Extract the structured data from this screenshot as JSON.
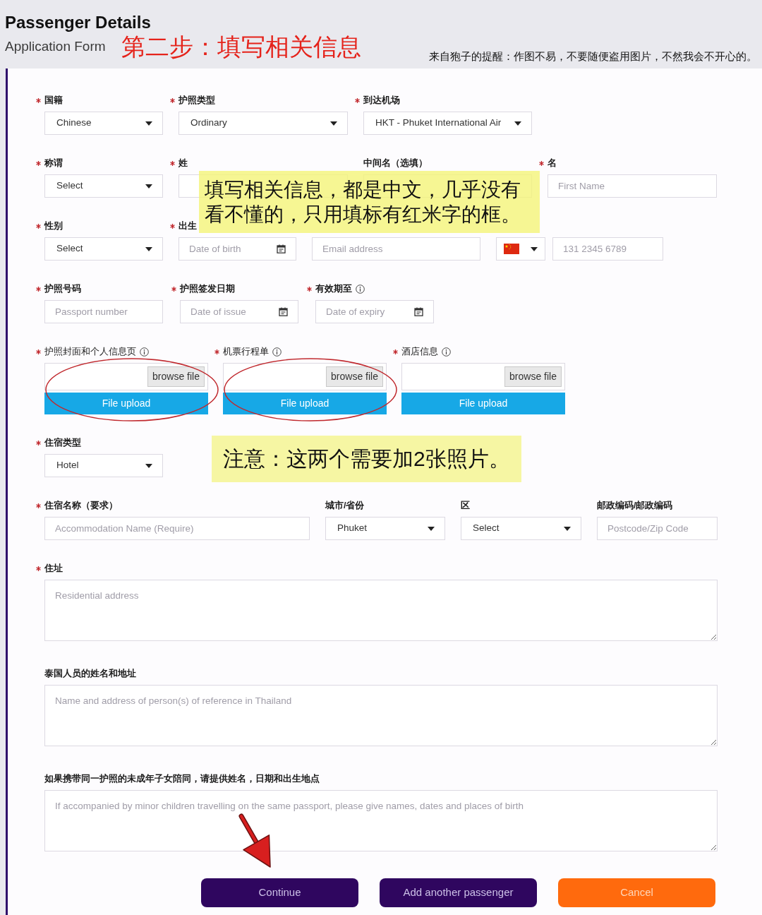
{
  "header": {
    "title": "Passenger Details",
    "subtitle": "Application Form",
    "annotation": "第二步：填写相关信息",
    "author_note": "来自狍子的提醒：作图不易，不要随便盗用图片，不然我会不开心的。"
  },
  "form": {
    "rows": [
      {
        "fields": [
          {
            "kind": "select",
            "label": "国籍",
            "required": true,
            "info": false,
            "value": "Chinese"
          },
          {
            "kind": "select",
            "label": "护照类型",
            "required": true,
            "info": false,
            "value": "Ordinary"
          },
          {
            "kind": "select",
            "label": "到达机场",
            "required": true,
            "info": false,
            "value": "HKT - Phuket International Air"
          }
        ]
      },
      {
        "fields": [
          {
            "kind": "select",
            "label": "称谓",
            "required": true,
            "info": false,
            "value": "Select"
          },
          {
            "kind": "input",
            "label": "姓",
            "required": true,
            "info": false
          },
          {
            "kind": "input",
            "label": "中间名（选填）",
            "required": false,
            "info": false
          },
          {
            "kind": "input",
            "label": "名",
            "required": true,
            "info": false,
            "placeholder": "First Name"
          }
        ],
        "note": {
          "kind": "overlay",
          "text": "填写相关信息，都是中文，几乎没有看不懂的，只用填标有红米字的框。"
        }
      },
      {
        "fields": [
          {
            "kind": "select",
            "label": "性别",
            "required": true,
            "info": false,
            "value": "Select"
          },
          {
            "kind": "date",
            "label": "出生",
            "required": true,
            "info": false,
            "placeholder": "Date of birth"
          },
          {
            "kind": "input",
            "placeholder": "Email address"
          },
          {
            "kind": "phone",
            "placeholder": "131 2345 6789"
          }
        ]
      },
      {
        "fields": [
          {
            "kind": "input",
            "label": "护照号码",
            "required": true,
            "info": false,
            "placeholder": "Passport number"
          },
          {
            "kind": "date",
            "label": "护照签发日期",
            "required": true,
            "info": false,
            "placeholder": "Date of issue"
          },
          {
            "kind": "date",
            "label": "有效期至",
            "required": true,
            "info": true,
            "placeholder": "Date of expiry"
          }
        ]
      },
      {
        "fields": [
          {
            "kind": "file",
            "label": "护照封面和个人信息页",
            "required": true,
            "info": true,
            "browse": "browse file",
            "upload": "File upload",
            "circled": true
          },
          {
            "kind": "file",
            "label": "机票行程单",
            "required": true,
            "info": true,
            "browse": "browse file",
            "upload": "File upload",
            "circled": true
          },
          {
            "kind": "file",
            "label": "酒店信息",
            "required": true,
            "info": true,
            "browse": "browse file",
            "upload": "File upload",
            "circled": false
          }
        ]
      },
      {
        "fields": [
          {
            "kind": "select",
            "label": "住宿类型",
            "required": true,
            "info": false,
            "value": "Hotel"
          }
        ],
        "note": {
          "kind": "inline",
          "text": "注意：这两个需要加2张照片。"
        }
      },
      {
        "fields": [
          {
            "kind": "input",
            "label": "住宿名称（要求）",
            "required": true,
            "info": false,
            "placeholder": "Accommodation Name (Require)"
          },
          {
            "kind": "select",
            "label": "城市/省份",
            "required": false,
            "info": false,
            "value": "Phuket"
          },
          {
            "kind": "select",
            "label": "区",
            "required": false,
            "info": false,
            "value": "Select"
          },
          {
            "kind": "input",
            "label": "邮政编码/邮政编码",
            "required": false,
            "info": false,
            "placeholder": "Postcode/Zip Code"
          }
        ]
      },
      {
        "fields": [
          {
            "kind": "textarea",
            "label": "住址",
            "required": true,
            "info": false,
            "placeholder": "Residential address"
          }
        ]
      },
      {
        "fields": [
          {
            "kind": "textarea",
            "label": "泰国人员的姓名和地址",
            "required": false,
            "info": false,
            "placeholder": "Name and address of person(s) of reference in Thailand"
          }
        ]
      },
      {
        "fields": [
          {
            "kind": "textarea",
            "label": "如果携带同一护照的未成年子女陪同，请提供姓名，日期和出生地点",
            "required": false,
            "info": false,
            "placeholder": "If accompanied by minor children travelling on the same passport, please give names, dates and places of birth"
          }
        ]
      }
    ],
    "buttons": [
      {
        "label": "Continue",
        "kind": "primary",
        "arrow": true
      },
      {
        "label": "Add another passenger",
        "kind": "primary",
        "arrow": false
      },
      {
        "label": "Cancel",
        "kind": "cancel",
        "arrow": false
      }
    ]
  }
}
